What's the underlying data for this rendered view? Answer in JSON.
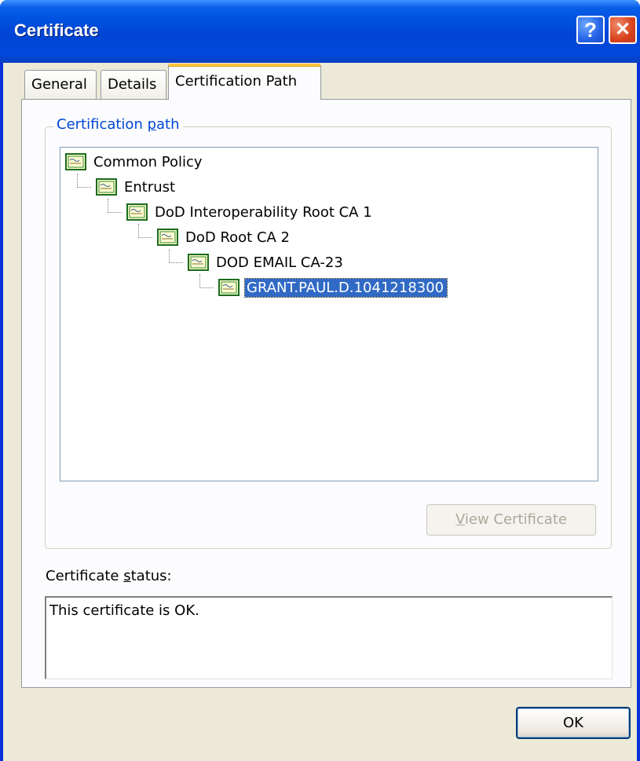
{
  "window": {
    "title": "Certificate",
    "help_label": "?",
    "close_label": "✕"
  },
  "tabs": [
    {
      "label": "General"
    },
    {
      "label": "Details"
    },
    {
      "label": "Certification Path"
    }
  ],
  "certification_path": {
    "legend_prefix": "Certification ",
    "legend_accel": "p",
    "legend_suffix": "ath",
    "nodes": [
      {
        "label": "Common Policy",
        "depth": 0
      },
      {
        "label": "Entrust",
        "depth": 1
      },
      {
        "label": "DoD Interoperability Root CA 1",
        "depth": 2
      },
      {
        "label": "DoD Root CA 2",
        "depth": 3
      },
      {
        "label": "DOD EMAIL CA-23",
        "depth": 4
      },
      {
        "label": "GRANT.PAUL.D.1041218300",
        "depth": 5,
        "selected": true
      }
    ],
    "view_button": {
      "accel": "V",
      "rest": "iew Certificate",
      "enabled": false
    }
  },
  "status": {
    "label_prefix": "Certificate ",
    "label_accel": "s",
    "label_suffix": "tatus:",
    "text": "This certificate is OK."
  },
  "ok_button": {
    "label": "OK"
  },
  "colors": {
    "titlebar": "#0053e0",
    "dialog_bg": "#ece9d8",
    "selection": "#316ac5",
    "group_legend": "#0046d5",
    "active_tab_accent": "#ffc83c"
  },
  "icons": {
    "tree_node": "certificate-icon",
    "help": "help-icon",
    "close": "close-icon"
  }
}
